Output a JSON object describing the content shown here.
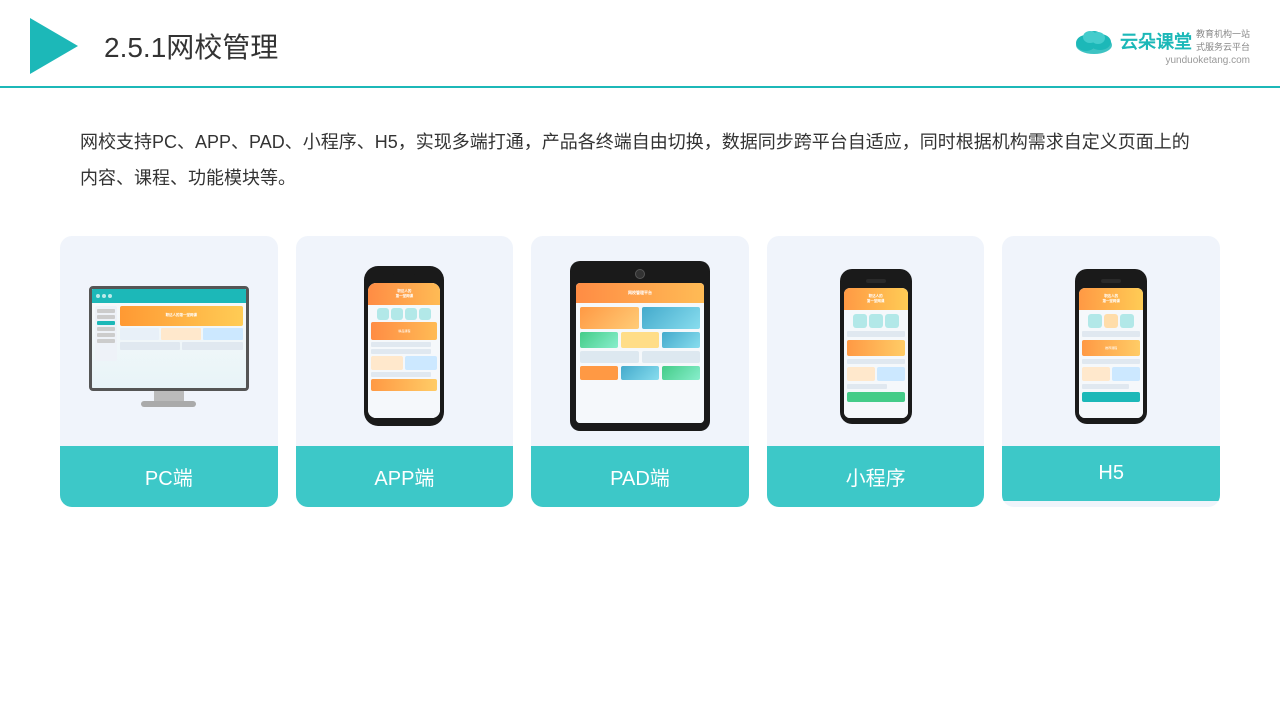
{
  "header": {
    "title_prefix": "2.5.1",
    "title_main": "网校管理",
    "brand_name": "云朵课堂",
    "brand_url": "yunduoketang.com",
    "brand_tagline_line1": "教育机构一站",
    "brand_tagline_line2": "式服务云平台"
  },
  "description": {
    "text": "网校支持PC、APP、PAD、小程序、H5，实现多端打通，产品各终端自由切换，数据同步跨平台自适应，同时根据机构需求自定义页面上的内容、课程、功能模块等。"
  },
  "cards": [
    {
      "id": "pc",
      "label": "PC端"
    },
    {
      "id": "app",
      "label": "APP端"
    },
    {
      "id": "pad",
      "label": "PAD端"
    },
    {
      "id": "miniprogram",
      "label": "小程序"
    },
    {
      "id": "h5",
      "label": "H5"
    }
  ],
  "colors": {
    "teal": "#3dc8c8",
    "accent": "#1cb8b8",
    "card_bg": "#eef2f9",
    "dark": "#333"
  }
}
